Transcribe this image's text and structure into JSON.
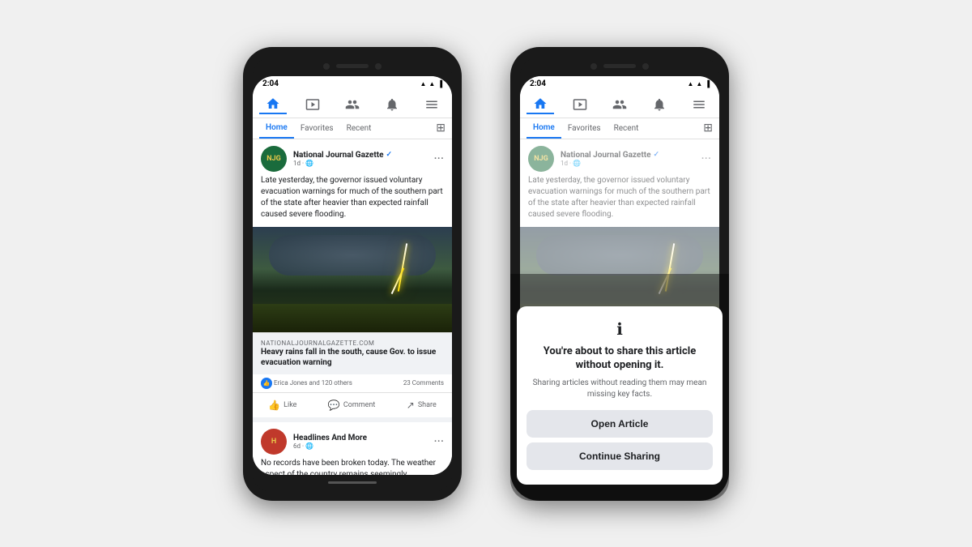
{
  "page": {
    "background_color": "#f0f0f0"
  },
  "phone_left": {
    "status": {
      "time": "2:04",
      "icons": "▲ ▲ ▐"
    },
    "nav_items": [
      "home",
      "watch",
      "groups",
      "notifications",
      "menu"
    ],
    "tabs": [
      "Home",
      "Favorites",
      "Recent"
    ],
    "post1": {
      "author": "National Journal Gazette",
      "verified": true,
      "time": "1d",
      "globe": "🌐",
      "text": "Late yesterday, the governor issued voluntary evacuation warnings for much of the southern part of the state after heavier than expected rainfall caused severe flooding.",
      "link_source": "NATIONALJOURNALGAZETTE.COM",
      "link_title": "Heavy rains fall in the south, cause Gov. to issue evacuation warning",
      "reactions": "Erica Jones and 120 others",
      "comments": "23 Comments",
      "actions": [
        "Like",
        "Comment",
        "Share"
      ]
    },
    "post2": {
      "author": "Headlines And More",
      "time": "6d",
      "globe": "🌐",
      "text": "No records have been broken today. The weather aspect of the country remains seemingly..."
    }
  },
  "phone_right": {
    "status": {
      "time": "2:04",
      "icons": "▲ ▲ ▐"
    },
    "nav_items": [
      "home",
      "watch",
      "groups",
      "notifications",
      "menu"
    ],
    "tabs": [
      "Home",
      "Favorites",
      "Recent"
    ],
    "post1": {
      "author": "National Journal Gazette",
      "verified": true,
      "time": "1d",
      "globe": "🌐",
      "text": "Late yesterday, the governor issued voluntary evacuation warnings for much of the southern part of the state after heavier than expected rainfall caused severe flooding."
    },
    "dialog": {
      "icon": "ℹ",
      "title": "You're about to share this article without opening it.",
      "subtitle": "Sharing articles without reading them may mean missing key facts.",
      "btn_open": "Open Article",
      "btn_continue": "Continue Sharing"
    }
  }
}
